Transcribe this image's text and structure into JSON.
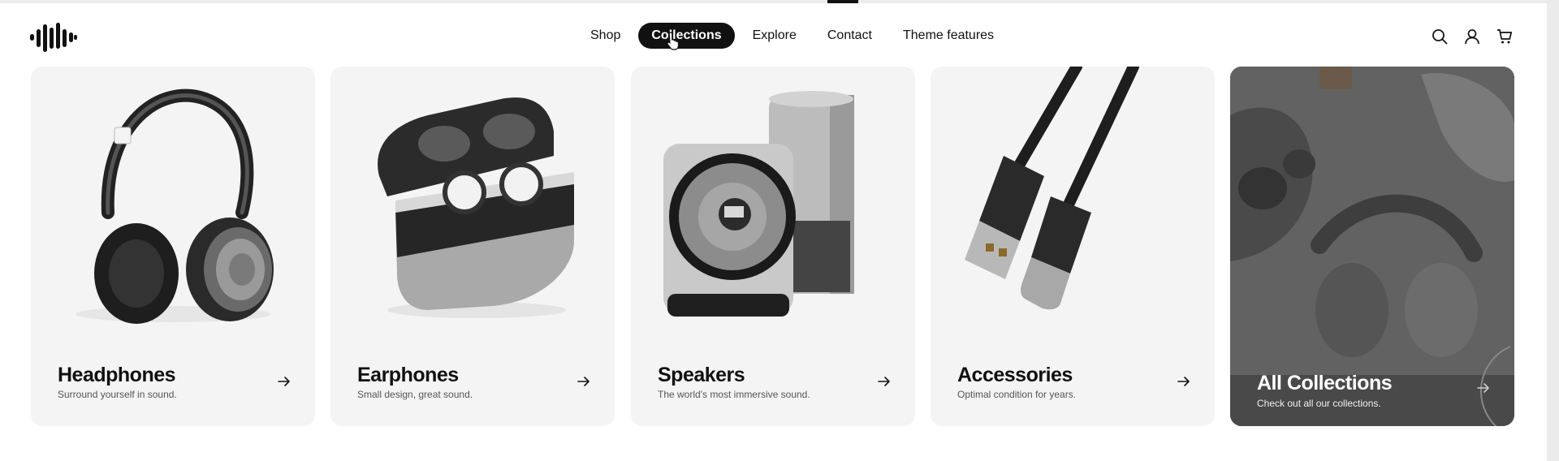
{
  "nav": {
    "items": [
      {
        "label": "Shop",
        "active": false
      },
      {
        "label": "Collections",
        "active": true
      },
      {
        "label": "Explore",
        "active": false
      },
      {
        "label": "Contact",
        "active": false
      },
      {
        "label": "Theme features",
        "active": false
      }
    ]
  },
  "header_icons": [
    "search-icon",
    "account-icon",
    "cart-icon"
  ],
  "cards": [
    {
      "title": "Headphones",
      "subtitle": "Surround yourself in sound.",
      "icon": "arrow-right-icon"
    },
    {
      "title": "Earphones",
      "subtitle": "Small design, great sound.",
      "icon": "arrow-right-icon"
    },
    {
      "title": "Speakers",
      "subtitle": "The world's most immersive sound.",
      "icon": "arrow-right-icon"
    },
    {
      "title": "Accessories",
      "subtitle": "Optimal condition for years.",
      "icon": "arrow-right-icon"
    },
    {
      "title": "All Collections",
      "subtitle": "Check out all our collections.",
      "icon": "arrow-right-icon"
    }
  ],
  "colors": {
    "accent": "#111111",
    "card_bg": "#f4f4f4",
    "page_bg": "#ffffff"
  }
}
